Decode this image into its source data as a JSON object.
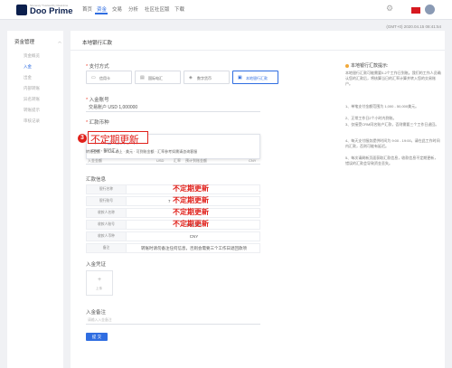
{
  "brand": {
    "name": "Doo Prime",
    "tagline": "Sincerely Trustworthy Real-time"
  },
  "nav": [
    "首页",
    "资金",
    "交易",
    "分析",
    "社区社区版",
    "下载"
  ],
  "timestamp": "(GMT+0) 2020.04.15 08:41:54",
  "sidebar": {
    "heading": "资金管理",
    "items": [
      "资金概览",
      "入金",
      "出金",
      "内部转账",
      "异名转账",
      "转账提示",
      "审核记录"
    ]
  },
  "panel": {
    "title": "本地银行汇款",
    "payment_label": "支付方式",
    "methods": [
      "信用卡",
      "国际电汇",
      "数字货币",
      "本地银行汇款"
    ],
    "account_label": "入金账号",
    "account_value": "交易账户 USD 1,000000",
    "currency_label": "汇款币种",
    "dropdown_options": [
      "CNY - 中国人民币(CNY)",
      "CNY - 银行汇入"
    ],
    "hint": "转账金额 · 少 100 以上 · 美元 · 可到账金额 · 汇率参考如需请咨询客服",
    "amount_labels": [
      "入金金额",
      "USD",
      "汇率",
      "预计到账金额",
      "CNY"
    ],
    "annotation": {
      "number": "3",
      "text": "不定期更新"
    },
    "info_label": "汇款信息",
    "info_rows": [
      {
        "key": "银行名称",
        "value": "",
        "red": "不定期更新"
      },
      {
        "key": "银行账号",
        "value": "7",
        "red": "不定期更新"
      },
      {
        "key": "收款人名称",
        "value": "",
        "red": "不定期更新"
      },
      {
        "key": "收款人账号",
        "value": "621 793",
        "red": "不定期更新"
      },
      {
        "key": "收款人币种",
        "value": "CNY",
        "red": ""
      },
      {
        "key": "备注",
        "value": "转账时请勿备注任何信息，否则会需要三个工作日退回款项",
        "red": ""
      }
    ],
    "proof_label": "入金凭证",
    "upload_label": "上传",
    "remark_label": "入金备注",
    "remark_placeholder": "请输入入金备注",
    "submit_label": "提 交"
  },
  "tips": {
    "title": "本地银行汇款提示:",
    "intro": "本地银行汇款可能需要0-2个工作日到账。我们的工作人员确认您的汇款后，将核算当日的汇率计算并转入您的交易账户。",
    "items": [
      "1、单笔支付金额范围为 1,000 - 50,000美元。",
      "2、正常工作日2个小时内到账。",
      "3、仅接受CRM同名账户汇款，否则需要三个工作日退回。",
      "4、每天支付服务提供时间为 9:00 - 19:00，请在此工作时间内汇款，否则可能有延迟。",
      "5、每次请刷新页面获取汇款信息，收款信息不定期更新，错误的汇款会导致资金丢失。"
    ]
  },
  "colors": {
    "accent": "#2f6de1",
    "annotation": "#e0201a",
    "tip_dot": "#f1a93b"
  }
}
